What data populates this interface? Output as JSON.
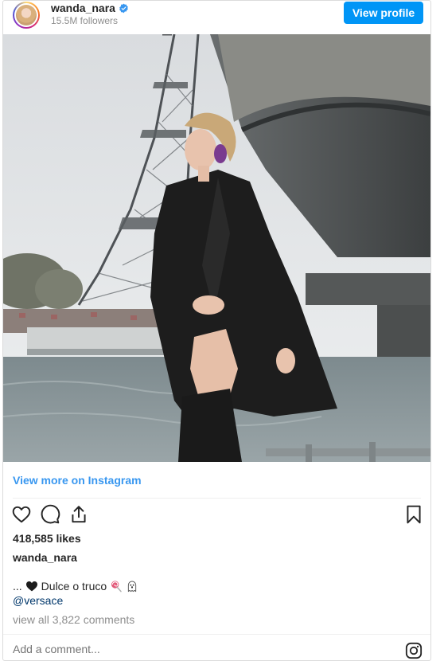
{
  "header": {
    "username": "wanda_nara",
    "followers": "15.5M followers",
    "view_profile_label": "View profile"
  },
  "links": {
    "view_more": "View more on Instagram"
  },
  "post": {
    "likes": "418,585 likes",
    "caption_user": "wanda_nara",
    "caption_prefix": "...",
    "caption_text": "Dulce o truco",
    "mention": "@versace",
    "comments_link": "view all 3,822 comments",
    "add_comment_placeholder": "Add a comment..."
  },
  "colors": {
    "accent_blue": "#0095f6",
    "link_blue": "#3897f0",
    "muted_gray": "#8e8e8e",
    "border_gray": "#dbdbdb"
  },
  "icons": [
    "verified-badge-icon",
    "heart-icon",
    "comment-icon",
    "share-icon",
    "bookmark-icon",
    "black-heart-icon",
    "lollipop-icon",
    "ghost-icon",
    "instagram-icon"
  ]
}
